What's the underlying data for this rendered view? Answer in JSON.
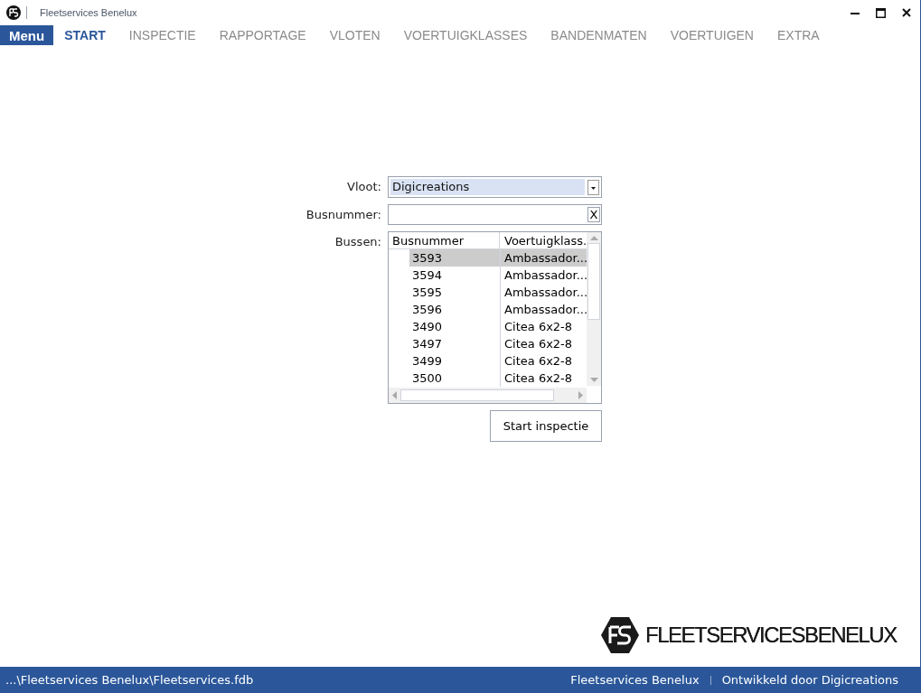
{
  "window": {
    "title": "Fleetservices Benelux"
  },
  "menu_button": "Menu",
  "tabs": [
    {
      "label": "START",
      "selected": true
    },
    {
      "label": "INSPECTIE",
      "selected": false
    },
    {
      "label": "RAPPORTAGE",
      "selected": false
    },
    {
      "label": "VLOTEN",
      "selected": false
    },
    {
      "label": "VOERTUIGKLASSES",
      "selected": false
    },
    {
      "label": "BANDENMATEN",
      "selected": false
    },
    {
      "label": "VOERTUIGEN",
      "selected": false
    },
    {
      "label": "EXTRA",
      "selected": false
    }
  ],
  "form": {
    "vloot_label": "Vloot:",
    "vloot_value": "Digicreations",
    "busnummer_label": "Busnummer:",
    "clear_button": "X",
    "bussen_label": "Bussen:"
  },
  "table": {
    "columns": [
      "Busnummer",
      "Voertuigklass."
    ],
    "rows": [
      {
        "cells": [
          "3593",
          "Ambassador..."
        ],
        "selected": true
      },
      {
        "cells": [
          "3594",
          "Ambassador..."
        ],
        "selected": false
      },
      {
        "cells": [
          "3595",
          "Ambassador..."
        ],
        "selected": false
      },
      {
        "cells": [
          "3596",
          "Ambassador..."
        ],
        "selected": false
      },
      {
        "cells": [
          "3490",
          "Citea 6x2-8"
        ],
        "selected": false
      },
      {
        "cells": [
          "3497",
          "Citea 6x2-8"
        ],
        "selected": false
      },
      {
        "cells": [
          "3499",
          "Citea 6x2-8"
        ],
        "selected": false
      },
      {
        "cells": [
          "3500",
          "Citea 6x2-8"
        ],
        "selected": false
      }
    ]
  },
  "start_button": "Start inspectie",
  "logo": "**FLEETSERVICES**BENELUX",
  "status_bar": {
    "path": "...\\Fleetservices Benelux\\Fleetservices.fdb",
    "company": "Fleetservices Benelux",
    "credit": "Ontwikkeld door Digicreations"
  }
}
